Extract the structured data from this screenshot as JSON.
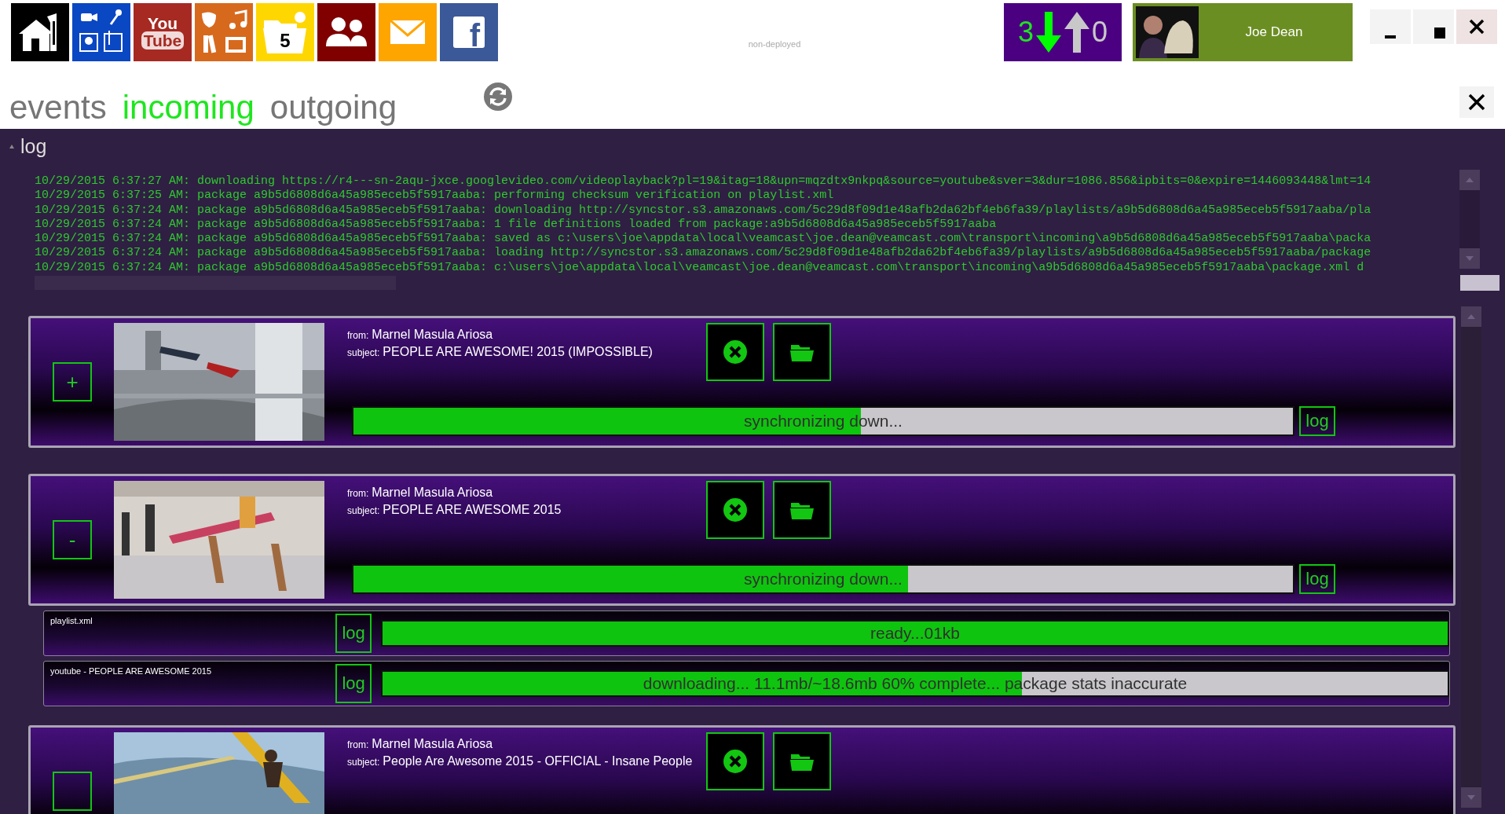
{
  "tiles": [
    {
      "kind": "home",
      "color": "#000000"
    },
    {
      "kind": "media",
      "color": "#0a47c2"
    },
    {
      "kind": "youtube",
      "color": "#a62a22",
      "label": "You",
      "label2": "Tube"
    },
    {
      "kind": "arts",
      "color": "#d7691d"
    },
    {
      "kind": "calendar",
      "color": "#ffd700",
      "label": "5"
    },
    {
      "kind": "people",
      "color": "#800000"
    },
    {
      "kind": "mail",
      "color": "#ffa500"
    },
    {
      "kind": "facebook",
      "color": "#3b5998",
      "label": "f"
    }
  ],
  "environment": "non-deployed",
  "transfer_counter": {
    "down": "3",
    "up": "0"
  },
  "user": {
    "name": "Joe Dean"
  },
  "tabs": [
    {
      "label": "events",
      "selected": false
    },
    {
      "label": "incoming",
      "selected": true
    },
    {
      "label": "outgoing",
      "selected": false
    }
  ],
  "log": {
    "title": "log",
    "lines": [
      "10/29/2015 6:37:27 AM: downloading https://r4---sn-2aqu-jxce.googlevideo.com/videoplayback?pl=19&itag=18&upn=mqzdtx9nkpq&source=youtube&sver=3&dur=1086.856&ipbits=0&expire=1446093448&lmt=14",
      "10/29/2015 6:37:25 AM: package a9b5d6808d6a45a985eceb5f5917aaba: performing checksum verification on playlist.xml",
      "10/29/2015 6:37:24 AM: package a9b5d6808d6a45a985eceb5f5917aaba: downloading http://syncstor.s3.amazonaws.com/5c29d8f09d1e48afb2da62bf4eb6fa39/playlists/a9b5d6808d6a45a985eceb5f5917aaba/pla",
      "10/29/2015 6:37:24 AM: package a9b5d6808d6a45a985eceb5f5917aaba: 1 file definitions loaded from package:a9b5d6808d6a45a985eceb5f5917aaba",
      "10/29/2015 6:37:24 AM: package a9b5d6808d6a45a985eceb5f5917aaba: saved as c:\\users\\joe\\appdata\\local\\veamcast\\joe.dean@veamcast.com\\transport\\incoming\\a9b5d6808d6a45a985eceb5f5917aaba\\packa",
      "10/29/2015 6:37:24 AM: package a9b5d6808d6a45a985eceb5f5917aaba: loading http://syncstor.s3.amazonaws.com/5c29d8f09d1e48afb2da62bf4eb6fa39/playlists/a9b5d6808d6a45a985eceb5f5917aaba/package",
      "10/29/2015 6:37:24 AM: package a9b5d6808d6a45a985eceb5f5917aaba: c:\\users\\joe\\appdata\\local\\veamcast\\joe.dean@veamcast.com\\transport\\incoming\\a9b5d6808d6a45a985eceb5f5917aaba\\package.xml d"
    ]
  },
  "packages": [
    {
      "toggle": "+",
      "from_label": "from:",
      "from": "Marnel Masula Ariosa",
      "subject_label": "subject:",
      "subject": "PEOPLE ARE AWESOME! 2015 (IMPOSSIBLE)",
      "status": "synchronizing down...",
      "level": 0.54,
      "log_button": "log"
    },
    {
      "toggle": "-",
      "from_label": "from:",
      "from": "Marnel Masula Ariosa",
      "subject_label": "subject:",
      "subject": "PEOPLE ARE AWESOME 2015",
      "status": "synchronizing down...",
      "level": 0.59,
      "log_button": "log",
      "files": [
        {
          "name": "playlist.xml",
          "log_button": "log",
          "status": "ready...01kb",
          "level": 1
        },
        {
          "name": "youtube - PEOPLE ARE AWESOME 2015",
          "log_button": "log",
          "status": "downloading... 11.1mb/~18.6mb 60% complete... package stats inaccurate",
          "level": 0.6
        }
      ]
    },
    {
      "from_label": "from:",
      "from": "Marnel Masula Ariosa",
      "subject_label": "subject:",
      "subject": "People Are Awesome 2015 - OFFICIAL - Insane People"
    }
  ]
}
